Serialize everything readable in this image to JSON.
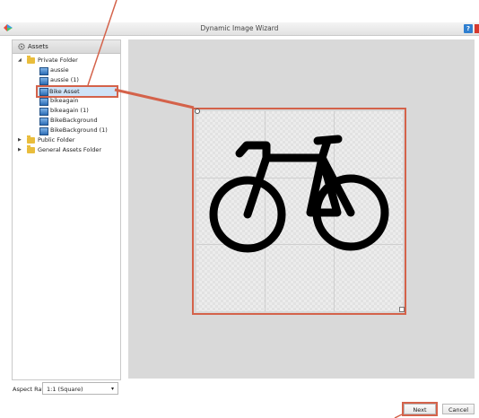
{
  "window": {
    "title": "Dynamic Image Wizard",
    "help_label": "?"
  },
  "assets_panel": {
    "header": "Assets",
    "tree": [
      {
        "label": "Private Folder",
        "type": "folder",
        "expanded": true,
        "level": 0
      },
      {
        "label": "aussie",
        "type": "image",
        "level": 1
      },
      {
        "label": "aussie (1)",
        "type": "image",
        "level": 1
      },
      {
        "label": "Bike Asset",
        "type": "image",
        "level": 1,
        "selected": true
      },
      {
        "label": "bikeagain",
        "type": "image",
        "level": 1
      },
      {
        "label": "bikeagain (1)",
        "type": "image",
        "level": 1
      },
      {
        "label": "BikeBackground",
        "type": "image",
        "level": 1
      },
      {
        "label": "BikeBackground (1)",
        "type": "image",
        "level": 1
      },
      {
        "label": "Public Folder",
        "type": "folder",
        "expanded": false,
        "level": 0
      },
      {
        "label": "General Assets Folder",
        "type": "folder",
        "expanded": false,
        "level": 0
      }
    ]
  },
  "aspect_ratio": {
    "label": "Aspect Ratio",
    "value": "1:1 (Square)"
  },
  "footer": {
    "next_label": "Next",
    "cancel_label": "Cancel"
  },
  "colors": {
    "highlight": "#d4624a",
    "selected_bg": "#cfe3f7",
    "canvas_bg": "#d9d9d9"
  }
}
